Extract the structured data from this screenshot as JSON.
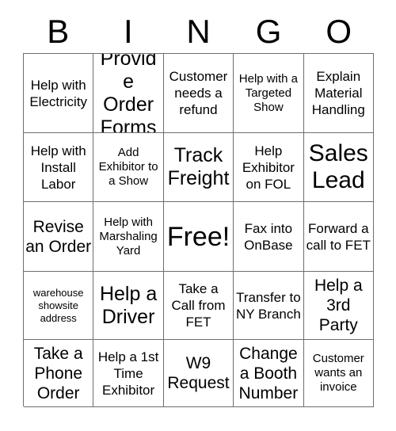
{
  "header": {
    "letters": [
      "B",
      "I",
      "N",
      "G",
      "O"
    ]
  },
  "grid": {
    "columns": 5,
    "rows": 5,
    "cells": [
      {
        "text": "Help with Electricity",
        "size": "fs-md"
      },
      {
        "text": "Provide Order Forms",
        "size": "fs-xl"
      },
      {
        "text": "Customer needs a refund",
        "size": "fs-md"
      },
      {
        "text": "Help with a Targeted Show",
        "size": "fs-sm"
      },
      {
        "text": "Explain Material Handling",
        "size": "fs-md"
      },
      {
        "text": "Help with Install Labor",
        "size": "fs-md"
      },
      {
        "text": "Add Exhibitor to a Show",
        "size": "fs-sm"
      },
      {
        "text": "Track Freight",
        "size": "fs-xl"
      },
      {
        "text": "Help Exhibitor on FOL",
        "size": "fs-md"
      },
      {
        "text": "Sales Lead",
        "size": "fs-xxl"
      },
      {
        "text": "Revise an Order",
        "size": "fs-lg"
      },
      {
        "text": "Help with Marshaling Yard",
        "size": "fs-sm"
      },
      {
        "text": "Free!",
        "size": "fs-free"
      },
      {
        "text": "Fax into OnBase",
        "size": "fs-md"
      },
      {
        "text": "Forward a call to FET",
        "size": "fs-md"
      },
      {
        "text": "warehouse showsite address",
        "size": "fs-xs"
      },
      {
        "text": "Help a Driver",
        "size": "fs-xl"
      },
      {
        "text": "Take a Call from FET",
        "size": "fs-md"
      },
      {
        "text": "Transfer to NY Branch",
        "size": "fs-md"
      },
      {
        "text": "Help a 3rd Party",
        "size": "fs-lg"
      },
      {
        "text": "Take a Phone Order",
        "size": "fs-lg"
      },
      {
        "text": "Help a 1st Time Exhibitor",
        "size": "fs-md"
      },
      {
        "text": "W9 Request",
        "size": "fs-lg"
      },
      {
        "text": "Change a Booth Number",
        "size": "fs-lg"
      },
      {
        "text": "Customer wants an invoice",
        "size": "fs-sm"
      }
    ]
  },
  "colors": {
    "background": "#ffffff",
    "text": "#000000",
    "grid_line": "#6e6e6e"
  }
}
